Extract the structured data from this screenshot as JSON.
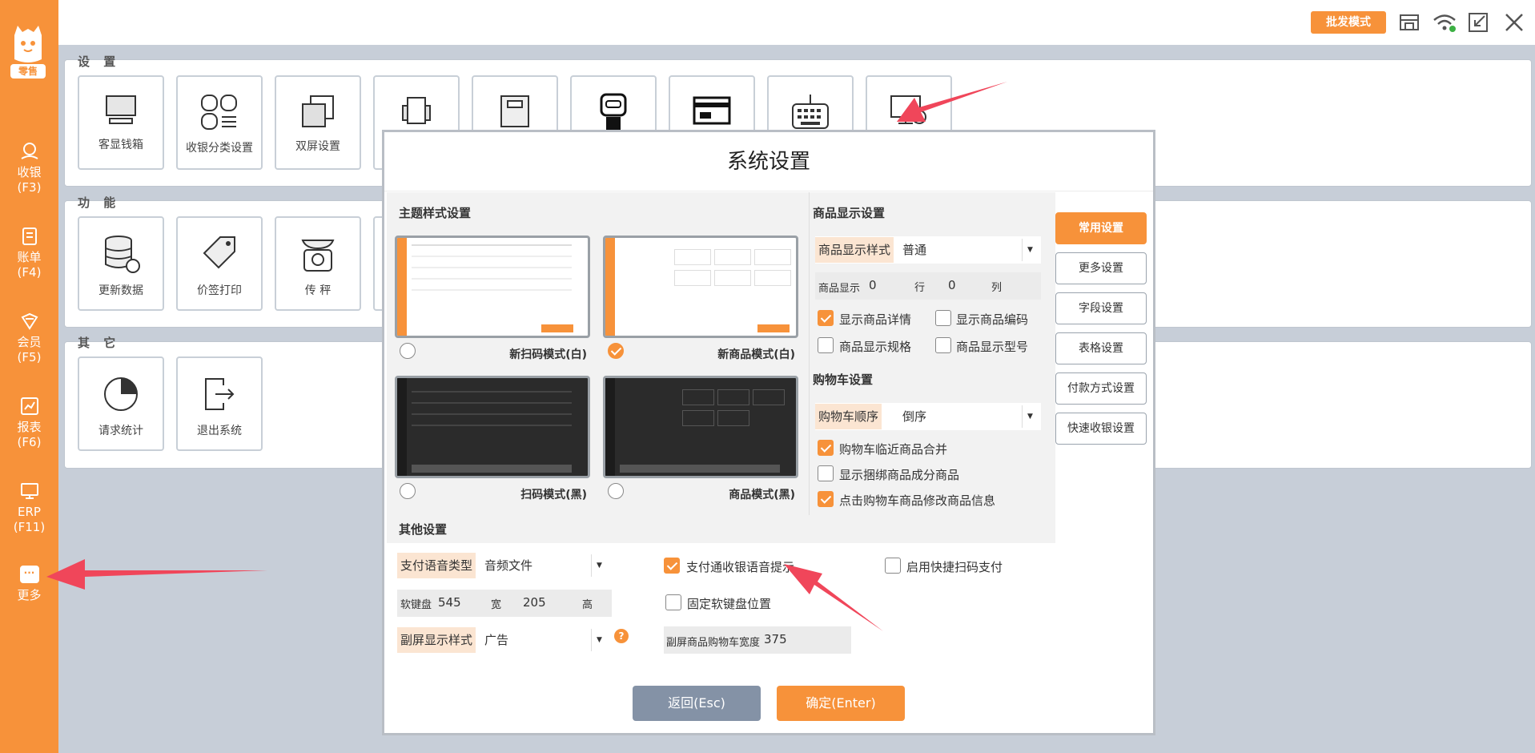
{
  "sidebar": {
    "logo_badge": "零售",
    "items": [
      {
        "label": "收银",
        "key": "(F3)"
      },
      {
        "label": "账单",
        "key": "(F4)"
      },
      {
        "label": "会员",
        "key": "(F5)"
      },
      {
        "label": "报表",
        "key": "(F6)"
      },
      {
        "label": "ERP",
        "key": "(F11)"
      },
      {
        "label": "更多",
        "box": "···"
      }
    ]
  },
  "topbar": {
    "batch_mode": "批发模式"
  },
  "sections": {
    "settings": {
      "title": "设 置",
      "tiles": [
        "客显钱箱",
        "收银分类设置",
        "双屏设置"
      ]
    },
    "functions": {
      "title": "功 能",
      "tiles": [
        "更新数据",
        "价签打印",
        "传 秤"
      ]
    },
    "others": {
      "title": "其 它",
      "tiles": [
        "请求统计",
        "退出系统"
      ]
    }
  },
  "dialog": {
    "title": "系统设置",
    "theme": {
      "title": "主题样式设置",
      "options": [
        {
          "label": "新扫码模式(白)",
          "selected": false
        },
        {
          "label": "新商品模式(白)",
          "selected": true
        },
        {
          "label": "扫码模式(黑)",
          "selected": false
        },
        {
          "label": "商品模式(黑)",
          "selected": false
        }
      ]
    },
    "product": {
      "title": "商品显示设置",
      "style_label": "商品显示样式",
      "style_value": "普通",
      "grid_label": "商品显示",
      "rows": "0",
      "rows_unit": "行",
      "cols": "0",
      "cols_unit": "列",
      "checks": [
        {
          "label": "显示商品详情",
          "checked": true
        },
        {
          "label": "显示商品编码",
          "checked": false
        },
        {
          "label": "商品显示规格",
          "checked": false
        },
        {
          "label": "商品显示型号",
          "checked": false
        }
      ]
    },
    "cart": {
      "title": "购物车设置",
      "order_label": "购物车顺序",
      "order_value": "倒序",
      "checks": [
        {
          "label": "购物车临近商品合并",
          "checked": true
        },
        {
          "label": "显示捆绑商品成分商品",
          "checked": false
        },
        {
          "label": "点击购物车商品修改商品信息",
          "checked": true
        }
      ]
    },
    "other": {
      "title": "其他设置",
      "voice_label": "支付语音类型",
      "voice_value": "音频文件",
      "voice_tip": {
        "label": "支付通收银语音提示",
        "checked": true
      },
      "quick_scan": {
        "label": "启用快捷扫码支付",
        "checked": false
      },
      "keyboard_label": "软键盘",
      "keyboard_w": "545",
      "width_label": "宽",
      "keyboard_h": "205",
      "height_label": "高",
      "fix_keyboard": {
        "label": "固定软键盘位置",
        "checked": false
      },
      "secondary_label": "副屏显示样式",
      "secondary_value": "广告",
      "help": "?",
      "cart_width_label": "副屏商品购物车宽度",
      "cart_width_value": "375"
    },
    "side_buttons": [
      "常用设置",
      "更多设置",
      "字段设置",
      "表格设置",
      "付款方式设置",
      "快速收银设置"
    ],
    "back": "返回(Esc)",
    "confirm": "确定(Enter)"
  },
  "colors": {
    "accent": "#f7923a",
    "arrow": "#f0465a",
    "back": "#8492a6"
  }
}
